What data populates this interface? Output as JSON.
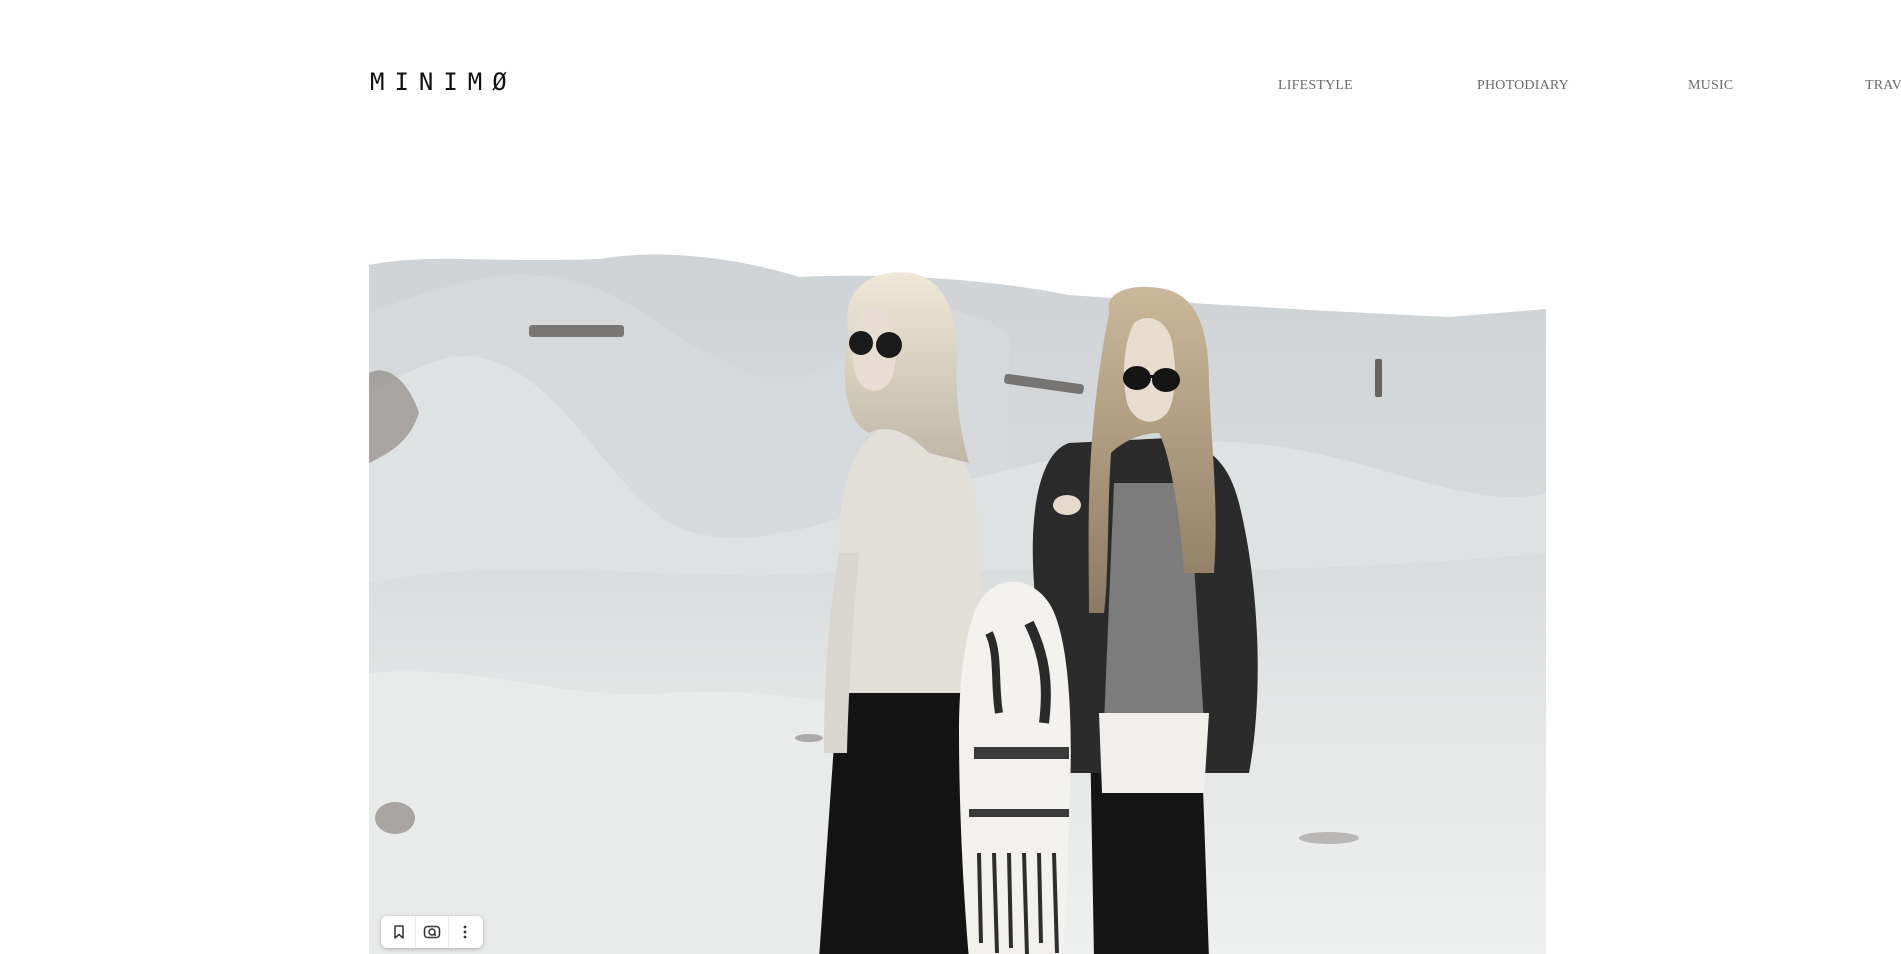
{
  "brand": {
    "logo_text": "MINIMØ"
  },
  "nav": {
    "items": [
      {
        "label": "LIFESTYLE"
      },
      {
        "label": "PHOTODIARY"
      },
      {
        "label": "MUSIC"
      },
      {
        "label": "TRAVEL"
      }
    ]
  },
  "hero": {
    "image_icon": "hero-photo"
  },
  "image_toolbar": {
    "icons": [
      "bookmark-icon",
      "lens-icon",
      "more-vertical-icon"
    ]
  },
  "colors": {
    "background": "#ffffff",
    "logo": "#111111",
    "nav_text": "#6b6b6b"
  }
}
